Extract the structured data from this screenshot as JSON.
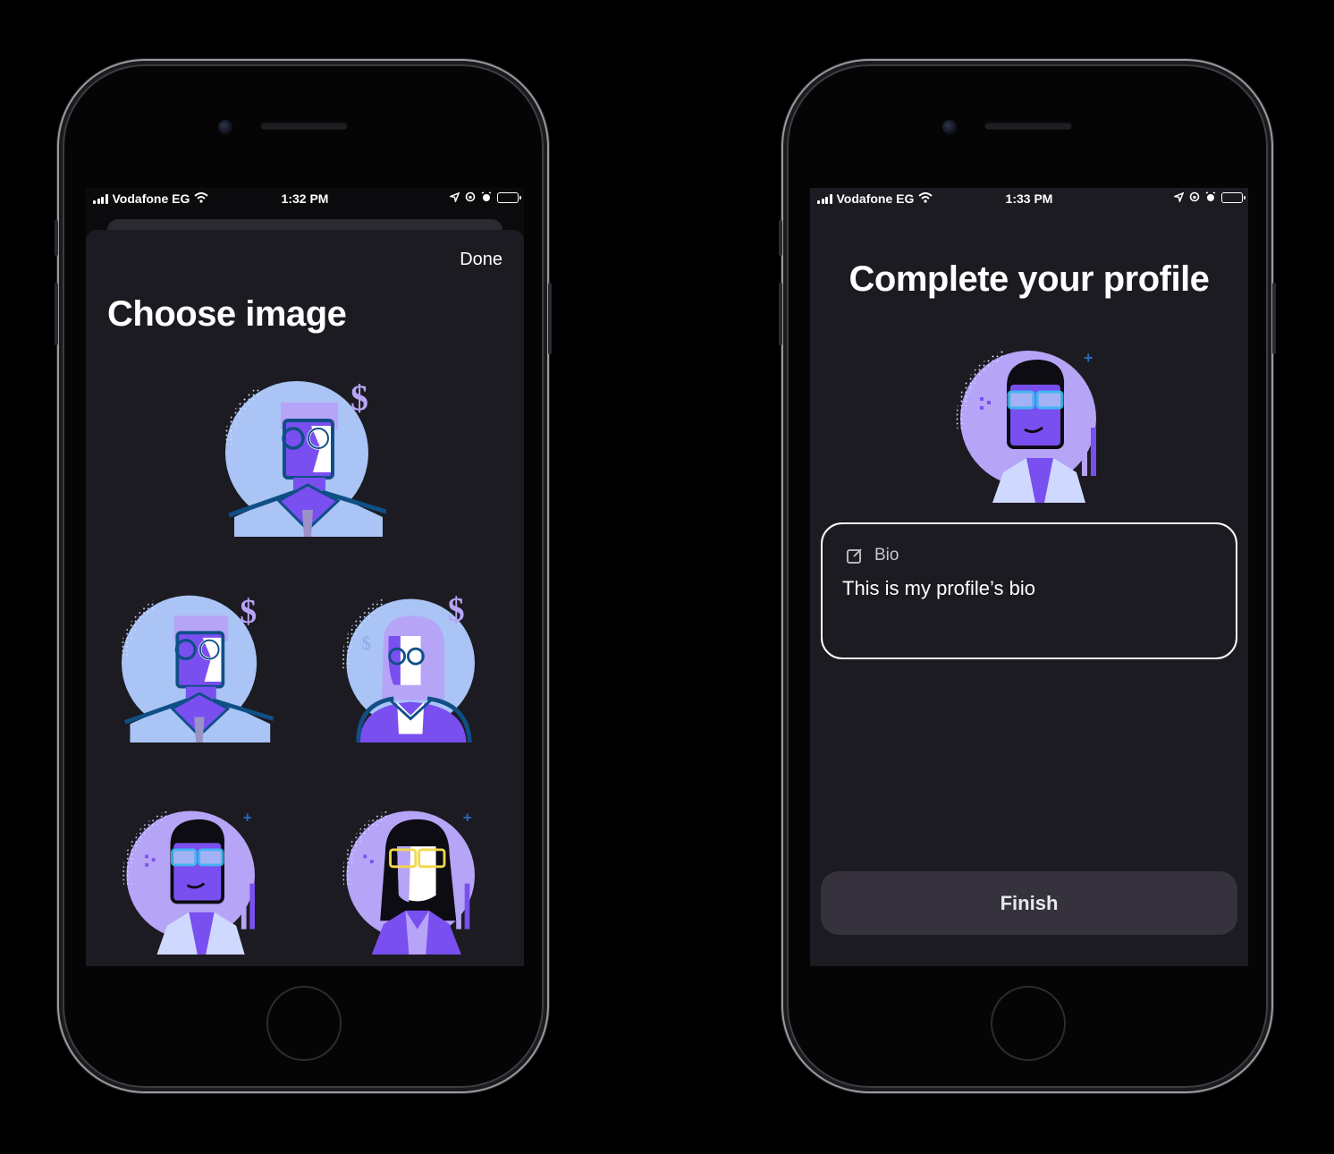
{
  "left_screen": {
    "status": {
      "carrier": "Vodafone EG",
      "time": "1:32 PM"
    },
    "done_label": "Done",
    "title": "Choose image",
    "avatars": [
      "avatar-man-glasses-dollar",
      "avatar-man-glasses-dollar",
      "avatar-woman-glasses-dollar",
      "avatar-man-sunglasses",
      "avatar-woman-sunglasses"
    ]
  },
  "right_screen": {
    "status": {
      "carrier": "Vodafone EG",
      "time": "1:33 PM"
    },
    "title": "Complete your profile",
    "bio": {
      "label": "Bio",
      "value": "This is my profile’s bio",
      "icon": "edit-icon"
    },
    "finish_label": "Finish"
  },
  "colors": {
    "screen_bg": "#1c1b21",
    "button_bg": "#35323d",
    "avatar_light_blue": "#a9c4f5",
    "avatar_lavender": "#b6a4f7",
    "avatar_purple": "#7a4ff0",
    "avatar_dark_blue": "#0f4f86",
    "battery_green": "#33d04e"
  }
}
